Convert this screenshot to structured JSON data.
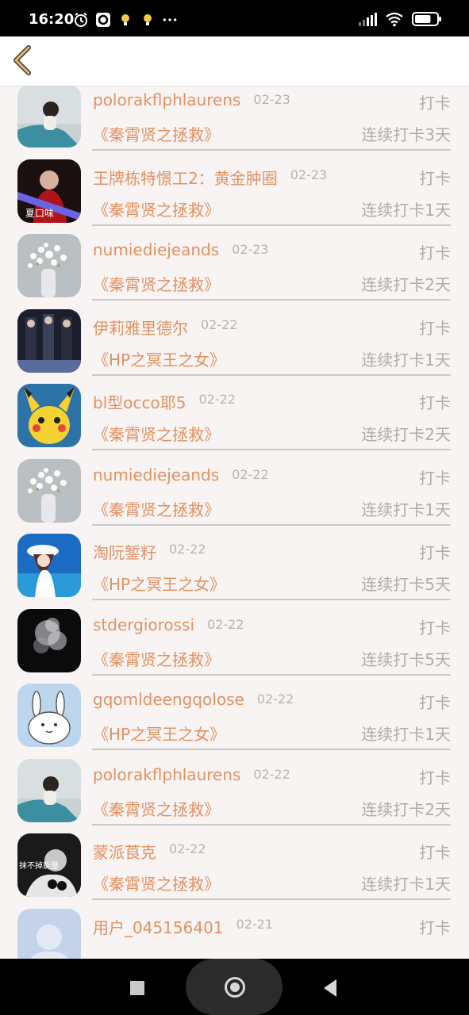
{
  "status_bar": {
    "time": "16:20",
    "battery_level": 0.75
  },
  "header": {
    "back_icon": "chevron-left-icon",
    "accent_color": "#e7b96a"
  },
  "colors": {
    "name_accent": "#e39161",
    "muted_text": "#b1abab",
    "background": "#f8f4f4"
  },
  "entries": [
    {
      "name": "polorakflphlaurens",
      "date": "02-23",
      "checkin": "打卡",
      "book": "《秦霄贤之拯救》",
      "streak": "连续打卡3天",
      "avatar": "woman-lying"
    },
    {
      "name": "王牌栋特憬工2：黄金肿圈",
      "date": "02-23",
      "checkin": "打卡",
      "book": "《秦霄贤之拯救》",
      "streak": "连续打卡1天",
      "avatar": "red-portrait",
      "avatar_text": "夏口味"
    },
    {
      "name": "numiediejeands",
      "date": "02-23",
      "checkin": "打卡",
      "book": "《秦霄贤之拯救》",
      "streak": "连续打卡2天",
      "avatar": "white-flowers"
    },
    {
      "name": "伊莉雅里德尔",
      "date": "02-22",
      "checkin": "打卡",
      "book": "《HP之冥王之女》",
      "streak": "连续打卡1天",
      "avatar": "dark-group"
    },
    {
      "name": "bl型occo耶5",
      "date": "02-22",
      "checkin": "打卡",
      "book": "《秦霄贤之拯救》",
      "streak": "连续打卡2天",
      "avatar": "pikachu"
    },
    {
      "name": "numiediejeands",
      "date": "02-22",
      "checkin": "打卡",
      "book": "《秦霄贤之拯救》",
      "streak": "连续打卡1天",
      "avatar": "white-flowers"
    },
    {
      "name": "淘阮錾籽",
      "date": "02-22",
      "checkin": "打卡",
      "book": "《HP之冥王之女》",
      "streak": "连续打卡5天",
      "avatar": "anime-girl-sky"
    },
    {
      "name": "stdergiorossi",
      "date": "02-22",
      "checkin": "打卡",
      "book": "《秦霄贤之拯救》",
      "streak": "连续打卡5天",
      "avatar": "smoke"
    },
    {
      "name": "gqomldeengqolose",
      "date": "02-22",
      "checkin": "打卡",
      "book": "《HP之冥王之女》",
      "streak": "连续打卡1天",
      "avatar": "white-rabbit"
    },
    {
      "name": "polorakflphlaurens",
      "date": "02-22",
      "checkin": "打卡",
      "book": "《秦霄贤之拯救》",
      "streak": "连续打卡2天",
      "avatar": "woman-lying"
    },
    {
      "name": "蒙派莨克",
      "date": "02-22",
      "checkin": "打卡",
      "book": "《秦霄贤之拯救》",
      "streak": "连续打卡1天",
      "avatar": "bw-portrait",
      "avatar_text": "抹不掉能量"
    },
    {
      "name": "用户_045156401",
      "date": "02-21",
      "checkin": "打卡",
      "book": "",
      "streak": "",
      "avatar": "default-user"
    }
  ],
  "nav_bar": {
    "recent_icon": "square-icon",
    "home_icon": "circle-home-icon",
    "back_icon": "triangle-back-icon"
  }
}
